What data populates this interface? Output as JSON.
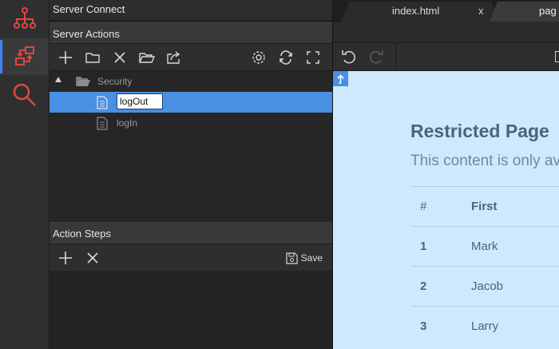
{
  "app": {
    "panel_title": "Server Connect"
  },
  "rail": {
    "items": [
      {
        "icon": "hierarchy-icon",
        "active": false
      },
      {
        "icon": "server-connect-icon",
        "active": true
      },
      {
        "icon": "search-icon",
        "active": false
      }
    ]
  },
  "server_actions": {
    "title": "Server Actions",
    "toolbar": [
      "add-icon",
      "new-folder-icon",
      "delete-icon",
      "open-folder-icon",
      "export-icon",
      "settings-icon",
      "refresh-icon",
      "fullscreen-icon"
    ],
    "tree": {
      "folder": "Security",
      "items": [
        {
          "label": "logOut",
          "selected": true,
          "editing": true
        },
        {
          "label": "logIn",
          "selected": false,
          "editing": false
        }
      ]
    }
  },
  "action_steps": {
    "title": "Action Steps",
    "save_label": "Save"
  },
  "tabs": [
    {
      "label": "index.html",
      "close": "x"
    },
    {
      "label": "pag"
    }
  ],
  "preview": {
    "title": "Restricted Page",
    "subtitle": "This content is only ava",
    "table": {
      "headers": [
        "#",
        "First"
      ],
      "rows": [
        [
          "1",
          "Mark"
        ],
        [
          "2",
          "Jacob"
        ],
        [
          "3",
          "Larry"
        ]
      ]
    }
  },
  "colors": {
    "accent": "#4a90e2",
    "preview_bg": "#cfe8fb",
    "rail_red": "#e0473f"
  }
}
